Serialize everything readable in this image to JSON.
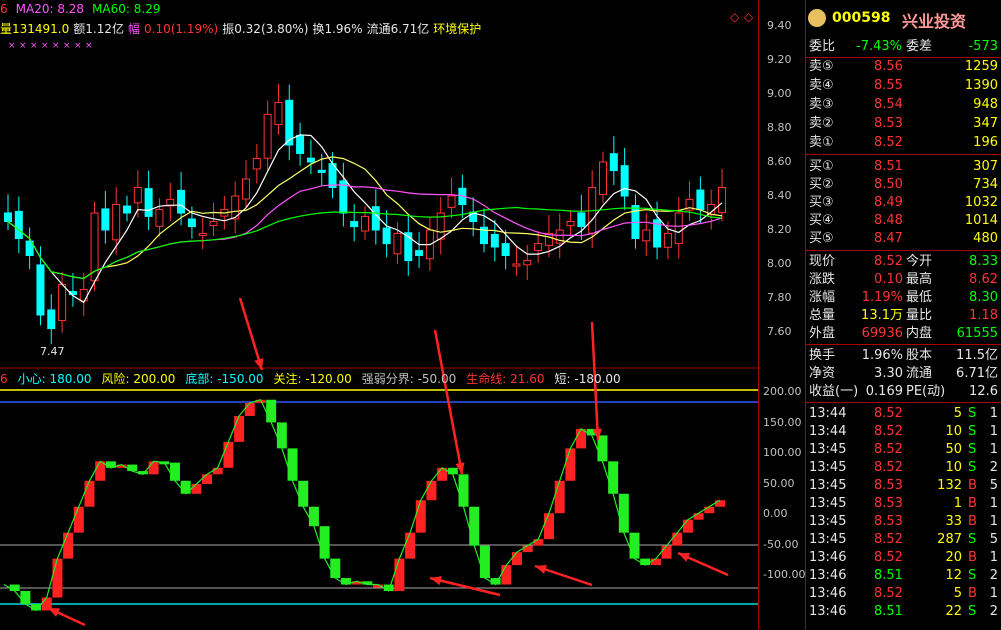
{
  "header": {
    "line1": [
      {
        "t": "6",
        "c": "#ff3333"
      },
      {
        "t": "MA20: 8.28",
        "c": "#ff55ff"
      },
      {
        "t": "MA60: 8.29",
        "c": "#00ff00"
      }
    ],
    "line2": [
      {
        "t": "量131491.0",
        "c": "#ffff00"
      },
      {
        "t": "额1.12亿",
        "c": "#e6e6e6"
      },
      {
        "t": "幅",
        "c": "#ff55ff"
      },
      {
        "t": "0.10(1.19%)",
        "c": "#ff3333"
      },
      {
        "t": "振0.32(3.80%)",
        "c": "#e6e6e6"
      },
      {
        "t": "换1.96%",
        "c": "#e6e6e6"
      },
      {
        "t": "流通6.71亿",
        "c": "#e6e6e6"
      },
      {
        "t": "环境保护",
        "c": "#ffff00"
      }
    ],
    "marks_icon": "diamond-icon"
  },
  "price_axis": [
    "9.40",
    "9.20",
    "9.00",
    "8.80",
    "8.60",
    "8.40",
    "8.20",
    "8.00",
    "7.80",
    "7.60"
  ],
  "price_low_label": "7.47",
  "indicator": {
    "items": [
      {
        "t": "6",
        "c": "#ff3333"
      },
      {
        "t": "小心: 180.00",
        "c": "#00ffff"
      },
      {
        "t": "风险: 200.00",
        "c": "#ffff00"
      },
      {
        "t": "底部: -150.00",
        "c": "#00ffff"
      },
      {
        "t": "关注: -120.00",
        "c": "#ffff00"
      },
      {
        "t": "强弱分界: -50.00",
        "c": "#c0c0c0"
      },
      {
        "t": "生命线: 21.60",
        "c": "#ff3333"
      },
      {
        "t": "短: -180.00",
        "c": "#e6e6e6"
      }
    ],
    "axis": [
      "200.00",
      "150.00",
      "100.00",
      "50.00",
      "0.00",
      "-50.00",
      "-100.00"
    ]
  },
  "quote": {
    "logo_text": "兴业投资",
    "code": "000598",
    "weibi_label": "委比",
    "weibi_value": "-7.43%",
    "weicha_label": "委差",
    "weicha_value": "-573",
    "sells": [
      {
        "label": "卖⑤",
        "price": "8.56",
        "vol": "1259"
      },
      {
        "label": "卖④",
        "price": "8.55",
        "vol": "1390"
      },
      {
        "label": "卖③",
        "price": "8.54",
        "vol": "948"
      },
      {
        "label": "卖②",
        "price": "8.53",
        "vol": "347"
      },
      {
        "label": "卖①",
        "price": "8.52",
        "vol": "196"
      }
    ],
    "buys": [
      {
        "label": "买①",
        "price": "8.51",
        "vol": "307"
      },
      {
        "label": "买②",
        "price": "8.50",
        "vol": "734"
      },
      {
        "label": "买③",
        "price": "8.49",
        "vol": "1032"
      },
      {
        "label": "买④",
        "price": "8.48",
        "vol": "1014"
      },
      {
        "label": "买⑤",
        "price": "8.47",
        "vol": "480"
      }
    ],
    "stats": [
      {
        "l1": "现价",
        "v1": "8.52",
        "c1": "#ff3333",
        "l2": "今开",
        "v2": "8.33",
        "c2": "#00ff00"
      },
      {
        "l1": "涨跌",
        "v1": "0.10",
        "c1": "#ff3333",
        "l2": "最高",
        "v2": "8.62",
        "c2": "#ff3333"
      },
      {
        "l1": "涨幅",
        "v1": "1.19%",
        "c1": "#ff3333",
        "l2": "最低",
        "v2": "8.30",
        "c2": "#00ff00"
      },
      {
        "l1": "总量",
        "v1": "13.1万",
        "c1": "#ffff00",
        "l2": "量比",
        "v2": "1.18",
        "c2": "#ff3333"
      },
      {
        "l1": "外盘",
        "v1": "69936",
        "c1": "#ff3333",
        "l2": "内盘",
        "v2": "61555",
        "c2": "#00ff00"
      }
    ],
    "finance": [
      {
        "l1": "换手",
        "v1": "1.96%",
        "l2": "股本",
        "v2": "11.5亿"
      },
      {
        "l1": "净资",
        "v1": "3.30",
        "l2": "流通",
        "v2": "6.71亿"
      },
      {
        "l1": "收益(一)",
        "v1": "0.169",
        "l2": "PE(动)",
        "v2": "12.6"
      }
    ],
    "ticks": [
      {
        "time": "13:44",
        "price": "8.52",
        "vol": "5",
        "bs": "S",
        "n": "1"
      },
      {
        "time": "13:44",
        "price": "8.52",
        "vol": "10",
        "bs": "S",
        "n": "1"
      },
      {
        "time": "13:45",
        "price": "8.52",
        "vol": "50",
        "bs": "S",
        "n": "1"
      },
      {
        "time": "13:45",
        "price": "8.52",
        "vol": "10",
        "bs": "S",
        "n": "2"
      },
      {
        "time": "13:45",
        "price": "8.53",
        "vol": "132",
        "bs": "B",
        "n": "5"
      },
      {
        "time": "13:45",
        "price": "8.53",
        "vol": "1",
        "bs": "B",
        "n": "1"
      },
      {
        "time": "13:45",
        "price": "8.53",
        "vol": "33",
        "bs": "B",
        "n": "1"
      },
      {
        "time": "13:45",
        "price": "8.52",
        "vol": "287",
        "bs": "S",
        "n": "5"
      },
      {
        "time": "13:46",
        "price": "8.52",
        "vol": "20",
        "bs": "B",
        "n": "1"
      },
      {
        "time": "13:46",
        "price": "8.51",
        "vol": "12",
        "bs": "S",
        "n": "2"
      },
      {
        "time": "13:46",
        "price": "8.52",
        "vol": "5",
        "bs": "B",
        "n": "1"
      },
      {
        "time": "13:46",
        "price": "8.51",
        "vol": "22",
        "bs": "S",
        "n": "2"
      }
    ]
  }
}
